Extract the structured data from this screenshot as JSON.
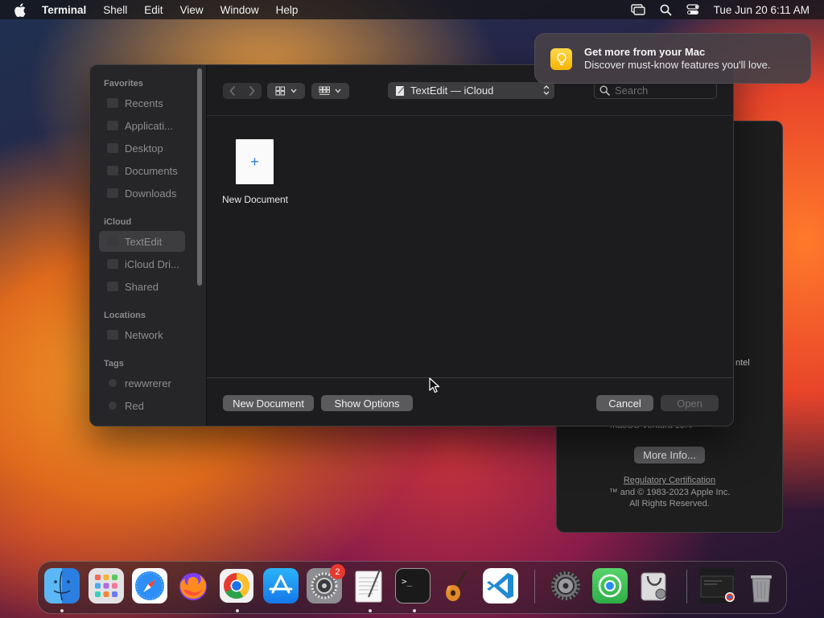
{
  "menubar": {
    "app_name": "Terminal",
    "menus": [
      "Shell",
      "Edit",
      "View",
      "Window",
      "Help"
    ],
    "clock": "Tue Jun 20  6:11 AM",
    "icons": [
      "apple-icon",
      "screen-mirroring-icon",
      "spotlight-search-icon",
      "control-center-icon"
    ]
  },
  "dialog": {
    "sidebar": {
      "favorites_header": "Favorites",
      "favorites": [
        "Recents",
        "Applicati...",
        "Desktop",
        "Documents",
        "Downloads"
      ],
      "icloud_header": "iCloud",
      "icloud": [
        "TextEdit",
        "iCloud Dri...",
        "Shared"
      ],
      "selected": "TextEdit",
      "locations_header": "Locations",
      "locations": [
        "Network"
      ],
      "tags_header": "Tags",
      "tags": [
        "rewwrerer",
        "Red"
      ]
    },
    "toolbar": {
      "location": "TextEdit — iCloud",
      "search_placeholder": "Search"
    },
    "files": [
      {
        "name": "New Document",
        "glyph": "+"
      }
    ],
    "buttons": {
      "new_document": "New Document",
      "show_options": "Show Options",
      "cancel": "Cancel",
      "open": "Open"
    }
  },
  "about_window": {
    "processor_fragment": "ntel",
    "macos_line": "macOS    Ventura 13.4",
    "more_info": "More Info...",
    "regulatory": "Regulatory Certification",
    "copyright": "™ and © 1983-2023 Apple Inc.",
    "rights": "All Rights Reserved."
  },
  "notification": {
    "title": "Get more from your Mac",
    "body": "Discover must-know features you'll love."
  },
  "dock": {
    "apps": [
      "Finder",
      "Launchpad",
      "Safari",
      "Firefox",
      "Chrome",
      "App Store",
      "System Settings",
      "TextEdit",
      "Terminal",
      "GarageBand",
      "Visual Studio Code",
      "System Preferences",
      "Find My",
      "Disk Utility"
    ],
    "extras": [
      "Minimized Window",
      "Trash"
    ],
    "settings_badge": "2"
  },
  "colors": {
    "accent": "#2a7bd6",
    "badge": "#e8372c",
    "notification_icon": "#f4b400"
  }
}
